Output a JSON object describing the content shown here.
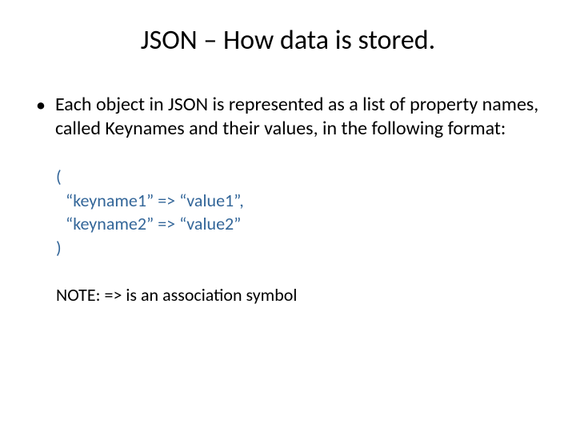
{
  "slide": {
    "title": "JSON – How data is stored.",
    "bullet1": "Each object in JSON is represented as a list of property names, called Keynames and their values, in the following format:",
    "code_line1": "(",
    "code_line2": "“keyname1” => “value1”,",
    "code_line3": "“keyname2” => “value2”",
    "code_line4": ")",
    "note": "NOTE: => is an association symbol"
  }
}
